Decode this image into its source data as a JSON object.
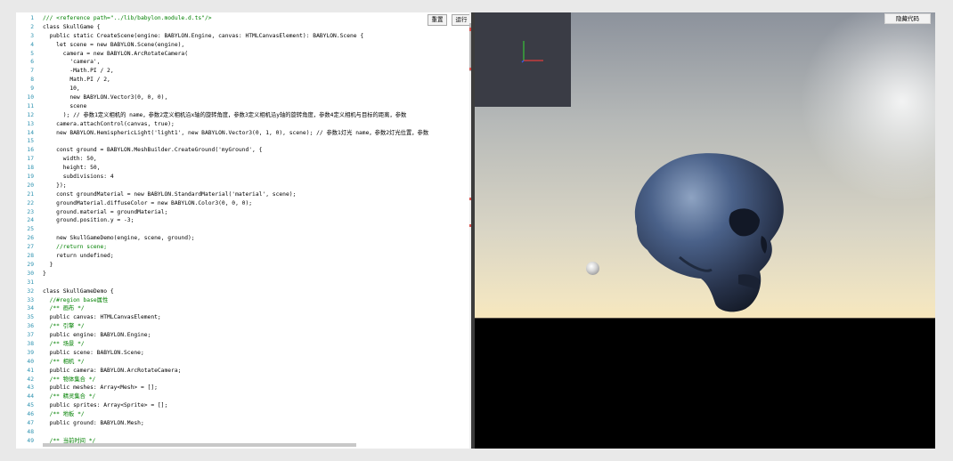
{
  "editor": {
    "run_button": "运行",
    "reset_button": "重置",
    "lines": [
      {
        "n": "1",
        "text": "/// <reference path=\"../lib/babylon.module.d.ts\"/>"
      },
      {
        "n": "2",
        "text": "class SkullGame {"
      },
      {
        "n": "3",
        "text": "  public static CreateScene(engine: BABYLON.Engine, canvas: HTMLCanvasElement): BABYLON.Scene {"
      },
      {
        "n": "4",
        "text": "    let scene = new BABYLON.Scene(engine),"
      },
      {
        "n": "5",
        "text": "      camera = new BABYLON.ArcRotateCamera("
      },
      {
        "n": "6",
        "text": "        'camera',"
      },
      {
        "n": "7",
        "text": "        -Math.PI / 2,"
      },
      {
        "n": "8",
        "text": "        Math.PI / 2,"
      },
      {
        "n": "9",
        "text": "        10,"
      },
      {
        "n": "10",
        "text": "        new BABYLON.Vector3(0, 0, 0),"
      },
      {
        "n": "11",
        "text": "        scene"
      },
      {
        "n": "12",
        "text": "      ); // 参数1定义相机的 name，参数2定义相机沿x轴的旋转角度，参数3定义相机沿y轴的旋转角度，参数4定义相机与目标的距离，参数"
      },
      {
        "n": "13",
        "text": "    camera.attachControl(canvas, true);"
      },
      {
        "n": "14",
        "text": "    new BABYLON.HemisphericLight('light1', new BABYLON.Vector3(0, 1, 0), scene); // 参数1灯光 name，参数2灯光位置，参数"
      },
      {
        "n": "15",
        "text": ""
      },
      {
        "n": "16",
        "text": "    const ground = BABYLON.MeshBuilder.CreateGround('myGround', {"
      },
      {
        "n": "17",
        "text": "      width: 50,"
      },
      {
        "n": "18",
        "text": "      height: 50,"
      },
      {
        "n": "19",
        "text": "      subdivisions: 4"
      },
      {
        "n": "20",
        "text": "    });"
      },
      {
        "n": "21",
        "text": "    const groundMaterial = new BABYLON.StandardMaterial('material', scene);"
      },
      {
        "n": "22",
        "text": "    groundMaterial.diffuseColor = new BABYLON.Color3(0, 0, 0);"
      },
      {
        "n": "23",
        "text": "    ground.material = groundMaterial;"
      },
      {
        "n": "24",
        "text": "    ground.position.y = -3;"
      },
      {
        "n": "25",
        "text": ""
      },
      {
        "n": "26",
        "text": "    new SkullGameDemo(engine, scene, ground);"
      },
      {
        "n": "27",
        "text": "    //return scene;"
      },
      {
        "n": "28",
        "text": "    return undefined;"
      },
      {
        "n": "29",
        "text": "  }"
      },
      {
        "n": "30",
        "text": "}"
      },
      {
        "n": "31",
        "text": ""
      },
      {
        "n": "32",
        "text": "class SkullGameDemo {"
      },
      {
        "n": "33",
        "text": "  //#region base属性"
      },
      {
        "n": "34",
        "text": "  /** 画布 */"
      },
      {
        "n": "35",
        "text": "  public canvas: HTMLCanvasElement;"
      },
      {
        "n": "36",
        "text": "  /** 引擎 */"
      },
      {
        "n": "37",
        "text": "  public engine: BABYLON.Engine;"
      },
      {
        "n": "38",
        "text": "  /** 场景 */"
      },
      {
        "n": "39",
        "text": "  public scene: BABYLON.Scene;"
      },
      {
        "n": "40",
        "text": "  /** 相机 */"
      },
      {
        "n": "41",
        "text": "  public camera: BABYLON.ArcRotateCamera;"
      },
      {
        "n": "42",
        "text": "  /** 物体集合 */"
      },
      {
        "n": "43",
        "text": "  public meshes: Array<Mesh> = [];"
      },
      {
        "n": "44",
        "text": "  /** 精灵集合 */"
      },
      {
        "n": "45",
        "text": "  public sprites: Array<Sprite> = [];"
      },
      {
        "n": "46",
        "text": "  /** 地板 */"
      },
      {
        "n": "47",
        "text": "  public ground: BABYLON.Mesh;"
      },
      {
        "n": "48",
        "text": ""
      },
      {
        "n": "49",
        "text": "  /** 当前时间 */"
      }
    ]
  },
  "viewport": {
    "hide_code_button": "隐藏代码",
    "colors": {
      "x_axis": "#e03c3c",
      "y_axis": "#38c238",
      "sky_top": "#8c929c",
      "horizon": "#f7e6bc",
      "ground": "#000000",
      "skull": "#3c5277"
    }
  }
}
